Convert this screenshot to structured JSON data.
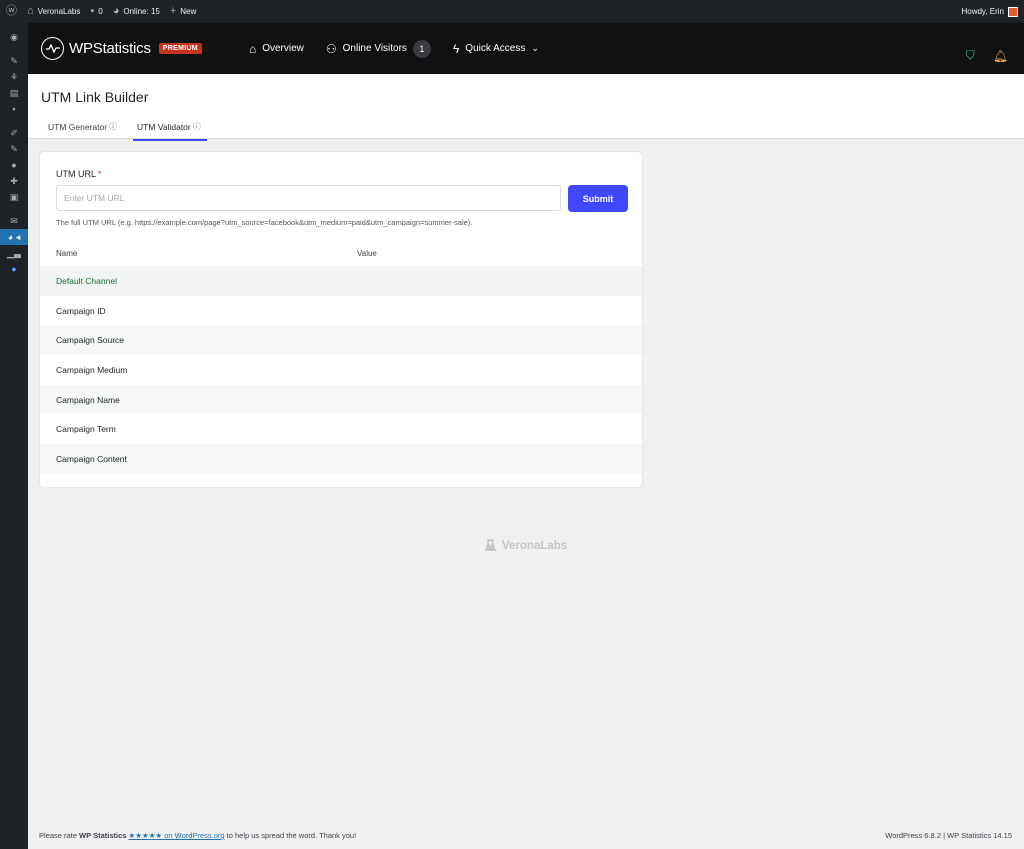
{
  "adminbar": {
    "site_name": "VeronaLabs",
    "comments_count": "0",
    "online_label": "Online: 15",
    "new_label": "New",
    "howdy": "Howdy, Erin"
  },
  "header": {
    "logo_text": "WPStatistics",
    "premium_badge": "PREMIUM",
    "nav": {
      "overview": "Overview",
      "online_visitors": "Online Visitors",
      "online_count": "1",
      "quick_access": "Quick Access"
    }
  },
  "page": {
    "title": "UTM Link Builder",
    "tabs": [
      {
        "label": "UTM Generator"
      },
      {
        "label": "UTM Validator"
      }
    ]
  },
  "form": {
    "label": "UTM URL",
    "required_mark": "*",
    "placeholder": "Enter UTM URL",
    "value": "",
    "submit": "Submit",
    "hint": "The full UTM URL (e.g. https://example.com/page?utm_source=facebook&utm_medium=paid&utm_campaign=summer-sale)."
  },
  "table": {
    "headers": {
      "name": "Name",
      "value": "Value"
    },
    "rows": [
      {
        "name": "Default Channel",
        "value": ""
      },
      {
        "name": "Campaign ID",
        "value": ""
      },
      {
        "name": "Campaign Source",
        "value": ""
      },
      {
        "name": "Campaign Medium",
        "value": ""
      },
      {
        "name": "Campaign Name",
        "value": ""
      },
      {
        "name": "Campaign Term",
        "value": ""
      },
      {
        "name": "Campaign Content",
        "value": ""
      }
    ]
  },
  "brand": "VeronaLabs",
  "footer": {
    "left_prefix": "Please rate",
    "plugin_name": "WP Statistics",
    "stars": "★★★★★",
    "link_text": "on WordPress.org",
    "left_suffix": "to help us spread the word. Thank you!",
    "right": "WordPress 6.8.2 | WP Statistics 14.15"
  },
  "colors": {
    "accent": "#4048ff",
    "header_bg": "#101113",
    "premium": "#c6341f",
    "default_channel_text": "#1e6b35"
  }
}
